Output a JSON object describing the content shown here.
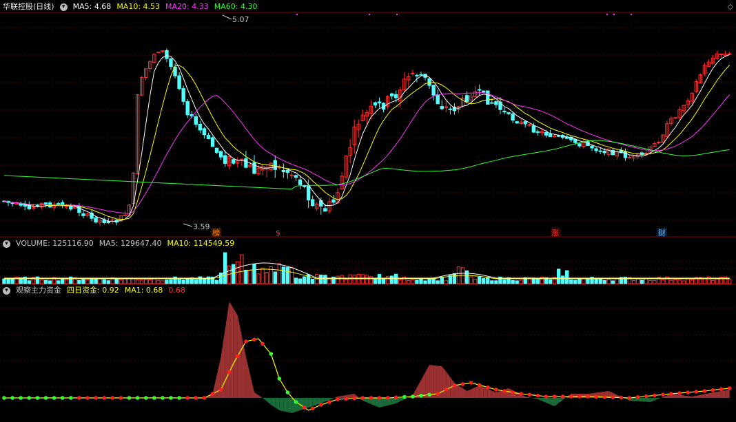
{
  "chart_data": [
    {
      "type": "candlestick",
      "title": "华联控股(日线)",
      "legend": [
        {
          "name": "MA5",
          "value": "4.68",
          "color": "#ffffff"
        },
        {
          "name": "MA10",
          "value": "4.53",
          "color": "#ffff00"
        },
        {
          "name": "MA20",
          "value": "4.33",
          "color": "#ff33ff"
        },
        {
          "name": "MA60",
          "value": "4.30",
          "color": "#33ff33"
        }
      ],
      "annotations": {
        "high": "5.07",
        "low": "3.59"
      },
      "markers": [
        "榜",
        "$",
        "涨",
        "财"
      ],
      "up_color": "#ff3030",
      "down_color": "#54ffff"
    },
    {
      "type": "bar",
      "title": "VOLUME",
      "legend": [
        {
          "name": "VOLUME",
          "value": "125116.90",
          "color": "#c8c8c8"
        },
        {
          "name": "MA5",
          "value": "129647.40",
          "color": "#c8c8c8"
        },
        {
          "name": "MA10",
          "value": "114549.59",
          "color": "#ffff00"
        }
      ]
    },
    {
      "type": "area",
      "title": "观察主力资金",
      "legend": [
        {
          "name": "四日资金",
          "value": "0.92",
          "color": "#ffff00"
        },
        {
          "name": "MA1",
          "value": "0.68",
          "color": "#ffff00"
        },
        {
          "name": "",
          "value": "0.68",
          "color": "#ff3030"
        }
      ]
    }
  ]
}
